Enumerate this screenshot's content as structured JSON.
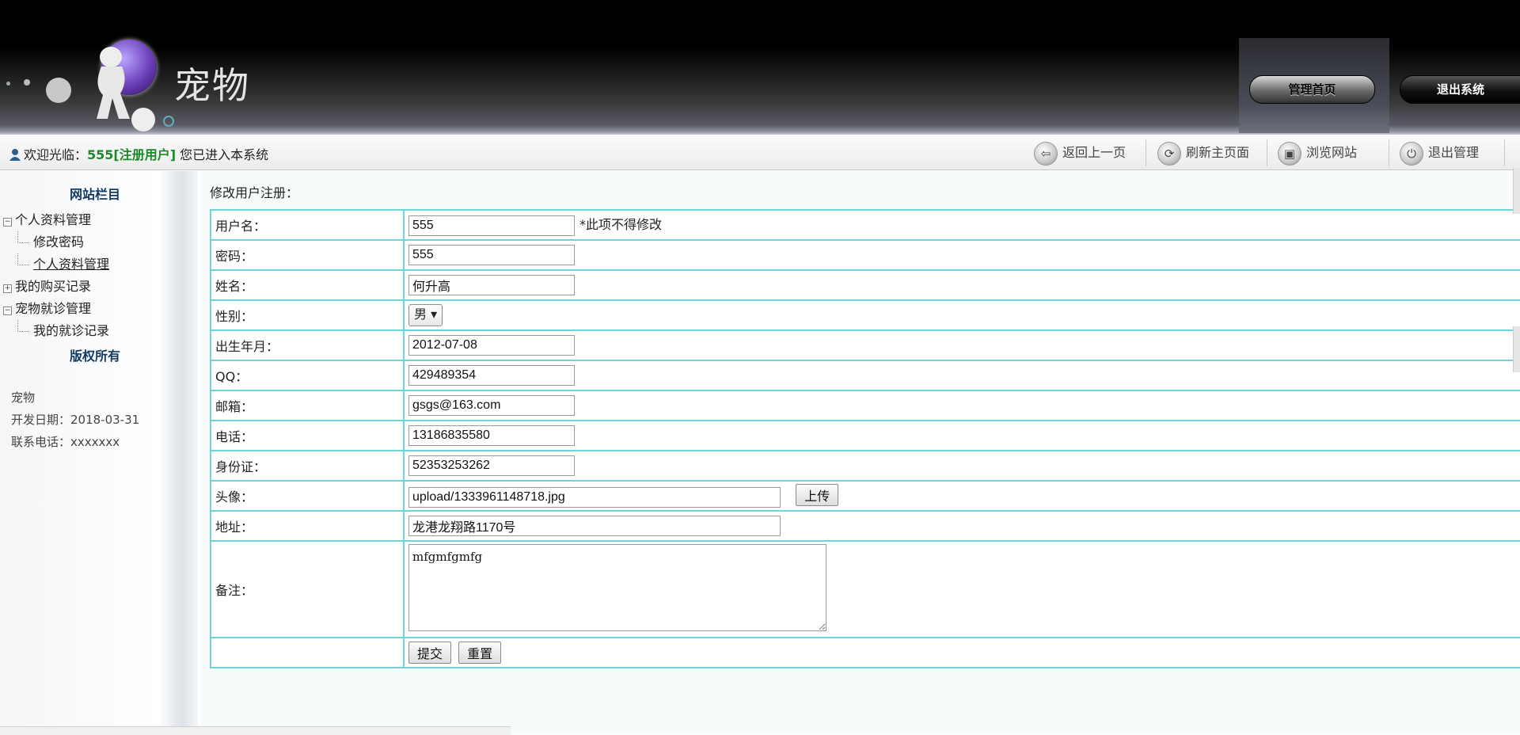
{
  "header": {
    "brand": "宠物",
    "home_button": "管理首页",
    "exit_button": "退出系统"
  },
  "toolbar": {
    "welcome_prefix": "欢迎光临：",
    "username": "555[注册用户]",
    "welcome_suffix": " 您已进入本系统",
    "actions": [
      {
        "label": "返回上一页",
        "icon": "back-arrow-icon",
        "glyph": "⇦"
      },
      {
        "label": "刷新主页面",
        "icon": "refresh-icon",
        "glyph": "⟳"
      },
      {
        "label": "浏览网站",
        "icon": "browse-icon",
        "glyph": "▣"
      },
      {
        "label": "退出管理",
        "icon": "power-icon",
        "glyph": "⏻"
      }
    ]
  },
  "sidebar": {
    "title": "网站栏目",
    "tree": {
      "group1": "个人资料管理",
      "group1_items": [
        "修改密码",
        "个人资料管理"
      ],
      "group2": "我的购买记录",
      "group3": "宠物就诊管理",
      "group3_items": [
        "我的就诊记录"
      ]
    },
    "copyright": "版权所有",
    "info": {
      "name": "宠物",
      "date": "开发日期：2018-03-31",
      "phone": "联系电话：xxxxxxx"
    }
  },
  "main": {
    "heading": "修改用户注册：",
    "fields": {
      "username_label": "用户名：",
      "username_value": "555",
      "username_hint": "*此项不得修改",
      "password_label": "密码：",
      "password_value": "555",
      "name_label": "姓名：",
      "name_value": "何升高",
      "gender_label": "性别：",
      "gender_value": "男",
      "birth_label": "出生年月：",
      "birth_value": "2012-07-08",
      "qq_label": "QQ：",
      "qq_value": "429489354",
      "email_label": "邮箱：",
      "email_value": "gsgs@163.com",
      "phone_label": "电话：",
      "phone_value": "13186835580",
      "idcard_label": "身份证：",
      "idcard_value": "52353253262",
      "avatar_label": "头像：",
      "avatar_value": "upload/1333961148718.jpg",
      "upload_button": "上传",
      "address_label": "地址：",
      "address_value": "龙港龙翔路1170号",
      "note_label": "备注：",
      "note_value": "mfgmfgmfg"
    },
    "submit_button": "提交",
    "reset_button": "重置"
  }
}
